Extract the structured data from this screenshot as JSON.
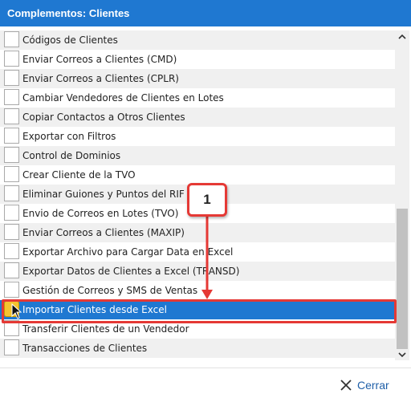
{
  "dialog": {
    "title": "Complementos: Clientes",
    "close_label": "Cerrar"
  },
  "list": {
    "items": [
      {
        "label": "Códigos de Clientes"
      },
      {
        "label": "Enviar Correos a Clientes (CMD)"
      },
      {
        "label": "Enviar Correos a Clientes (CPLR)"
      },
      {
        "label": "Cambiar Vendedores de Clientes en Lotes"
      },
      {
        "label": "Copiar Contactos a Otros Clientes"
      },
      {
        "label": "Exportar con Filtros"
      },
      {
        "label": "Control de Dominios"
      },
      {
        "label": "Crear Cliente de la TVO"
      },
      {
        "label": "Eliminar Guiones y Puntos del RIF"
      },
      {
        "label": "Envio de Correos en Lotes (TVO)"
      },
      {
        "label": "Enviar Correos a Clientes (MAXIP)"
      },
      {
        "label": "Exportar Archivo para Cargar Data en Excel"
      },
      {
        "label": "Exportar Datos de Clientes a Excel (TRANSD)"
      },
      {
        "label": "Gestión de Correos y SMS de Ventas"
      },
      {
        "label": "Importar Clientes desde Excel",
        "selected": true
      },
      {
        "label": "Transferir Clientes de un Vendedor"
      },
      {
        "label": "Transacciones de Clientes"
      }
    ]
  },
  "annotation": {
    "step_number": "1",
    "color": "#e53935"
  },
  "colors": {
    "accent": "#1f78d1",
    "selection_icon": "#f4c430"
  },
  "icons": {
    "close": "close-x-icon",
    "scroll_up": "chevron-up-icon",
    "scroll_down": "chevron-down-icon"
  }
}
